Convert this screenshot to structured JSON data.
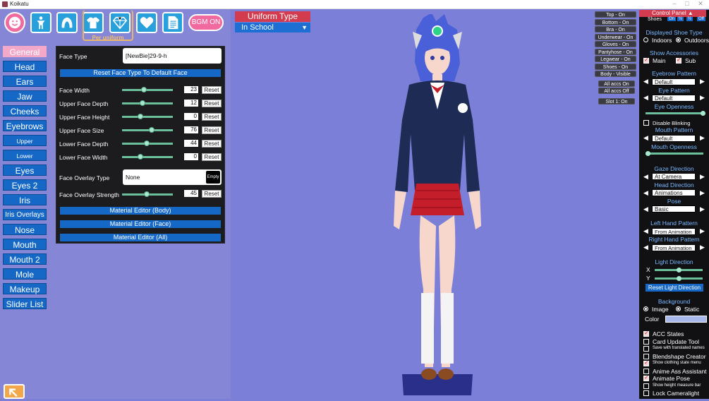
{
  "window": {
    "title": "Koikatu"
  },
  "top_icons": {
    "per_uniform_label": "Per uniform",
    "bgm_label": "BGM ON"
  },
  "categories": [
    {
      "label": "General"
    },
    {
      "label": "Head"
    },
    {
      "label": "Ears"
    },
    {
      "label": "Jaw"
    },
    {
      "label": "Cheeks"
    },
    {
      "label": "Eyebrows"
    },
    {
      "label": "Upper Eyelashes"
    },
    {
      "label": "Lower Eyelashes"
    },
    {
      "label": "Eyes"
    },
    {
      "label": "Eyes 2"
    },
    {
      "label": "Iris"
    },
    {
      "label": "Iris Overlays"
    },
    {
      "label": "Nose"
    },
    {
      "label": "Mouth"
    },
    {
      "label": "Mouth 2"
    },
    {
      "label": "Mole"
    },
    {
      "label": "Makeup"
    },
    {
      "label": "Slider List"
    }
  ],
  "face_panel": {
    "face_type_label": "Face Type",
    "face_type_value": "[NewBie]29-9-h",
    "reset_face_type": "Reset Face Type To Default Face",
    "reset_label": "Reset",
    "sliders": [
      {
        "label": "Face Width",
        "value": "23",
        "fraction": 0.43
      },
      {
        "label": "Upper Face Depth",
        "value": "12",
        "fraction": 0.4
      },
      {
        "label": "Upper Face Height",
        "value": "0",
        "fraction": 0.36
      },
      {
        "label": "Upper Face Size",
        "value": "76",
        "fraction": 0.58
      },
      {
        "label": "Lower Face Depth",
        "value": "44",
        "fraction": 0.48
      },
      {
        "label": "Lower Face Width",
        "value": "0",
        "fraction": 0.36
      }
    ],
    "overlay_type_label": "Face Overlay Type",
    "overlay_type_value": "None",
    "overlay_icon_text": "Empty",
    "overlay_strength_label": "Face Overlay Strength",
    "overlay_strength_value": "45",
    "overlay_strength_fraction": 0.48,
    "material_body": "Material Editor (Body)",
    "material_face": "Material Editor (Face)",
    "material_all": "Material Editor (All)"
  },
  "uniform": {
    "title": "Uniform Type",
    "value": "In School"
  },
  "clothing_toggles": [
    "Top - On",
    "Bottom - On",
    "Bra - On",
    "Underwear - On",
    "Gloves - On",
    "Pantyhose - On",
    "Legwear - On",
    "Shoes - On",
    "Body - Visible"
  ],
  "acc_toggles": [
    "All accs On",
    "All accs Off"
  ],
  "slot_label": "Slot 1: On",
  "control_panel": {
    "title": "Control Panel",
    "shoes_label": "Shoes",
    "shoe_states": [
      "On",
      "½",
      "½",
      "Off"
    ],
    "displayed_shoe_type": "Displayed Shoe Type",
    "indoors": "Indoors",
    "outdoors": "Outdoors",
    "show_accessories": "Show Accessories",
    "main": "Main",
    "sub": "Sub",
    "eyebrow_pattern": "Eyebrow Pattern",
    "eyebrow_value": "Default",
    "eye_pattern": "Eye Pattern",
    "eye_value": "Default",
    "eye_openness": "Eye Openness",
    "eye_openness_fraction": 1.0,
    "disable_blinking": "Disable Blinking",
    "mouth_pattern": "Mouth Pattern",
    "mouth_value": "Default",
    "mouth_openness": "Mouth Openness",
    "mouth_openness_fraction": 0.0,
    "gaze_direction": "Gaze Direction",
    "gaze_value": "At Camera",
    "head_direction": "Head Direction",
    "head_value": "Animations",
    "pose": "Pose",
    "pose_value": "Basic",
    "left_hand_pattern": "Left Hand Pattern",
    "left_hand_value": "From Animation",
    "right_hand_pattern": "Right Hand Pattern",
    "right_hand_value": "From Animation",
    "light_direction": "Light Direction",
    "x_label": "X",
    "y_label": "Y",
    "light_x_fraction": 0.5,
    "light_y_fraction": 0.5,
    "reset_light": "Reset Light Direction",
    "background": "Background",
    "image": "Image",
    "static": "Static",
    "color": "Color",
    "color_value": "#a9b8ea",
    "plugin_options": [
      {
        "label": "ACC States",
        "checked": true,
        "small": false
      },
      {
        "label": "Card Update Tool",
        "checked": false,
        "small": false
      },
      {
        "label": "Save with translated names",
        "checked": false,
        "small": true
      },
      {
        "label": "Blendshape Creator",
        "checked": false,
        "small": false
      },
      {
        "label": "Show clothing state menu",
        "checked": true,
        "small": true
      },
      {
        "label": "Anime Ass Assistant",
        "checked": false,
        "small": false
      },
      {
        "label": "Animate Pose",
        "checked": true,
        "small": false
      },
      {
        "label": "Show height measure bar",
        "checked": false,
        "small": true
      },
      {
        "label": "Lock Cameralight",
        "checked": false,
        "small": false
      }
    ]
  },
  "colors": {
    "scene_bg": "#7c7fd7",
    "accent_blue": "#1668c7",
    "accent_pink": "#f06aa0",
    "header_red": "#d33c4e"
  }
}
